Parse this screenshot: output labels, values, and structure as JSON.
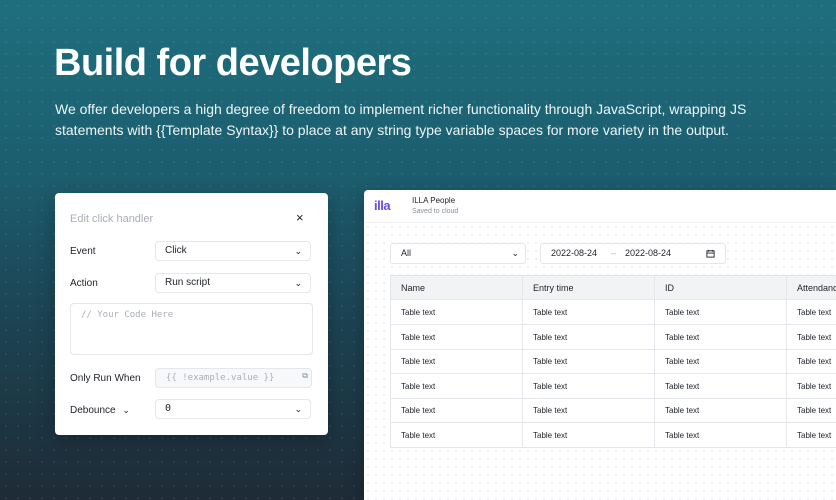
{
  "hero": {
    "headline": "Build for developers",
    "lead": "We offer developers a high degree of freedom to implement richer functionality through JavaScript, wrapping JS statements with {{Template Syntax}} to place at any string type variable spaces for more variety in the output."
  },
  "handler": {
    "title": "Edit click handler",
    "close_icon": "×",
    "event_label": "Event",
    "event_value": "Click",
    "action_label": "Action",
    "action_value": "Run script",
    "code_placeholder": "// Your Code Here",
    "only_run_label": "Only Run When",
    "only_run_placeholder": "{{ !example.value }}",
    "debounce_label": "Debounce",
    "debounce_value": "0",
    "chevron": "⌄"
  },
  "app": {
    "logo": "illa",
    "name": "ILLA People",
    "status": "Saved to cloud",
    "filter_value": "All",
    "date_start": "2022-08-24",
    "date_separator": "–",
    "date_end": "2022-08-24",
    "table": {
      "columns": [
        "Name",
        "Entry time",
        "ID",
        "Attendance"
      ],
      "rows": [
        [
          "Table text",
          "Table text",
          "Table text",
          "Table text"
        ],
        [
          "Table text",
          "Table text",
          "Table text",
          "Table text"
        ],
        [
          "Table text",
          "Table text",
          "Table text",
          "Table text"
        ],
        [
          "Table text",
          "Table text",
          "Table text",
          "Table text"
        ],
        [
          "Table text",
          "Table text",
          "Table text",
          "Table text"
        ],
        [
          "Table text",
          "Table text",
          "Table text",
          "Table text"
        ]
      ]
    }
  },
  "colors": {
    "brand": "#654aec",
    "background_top": "#1e6f7e",
    "background_bottom": "#1e2b36"
  }
}
